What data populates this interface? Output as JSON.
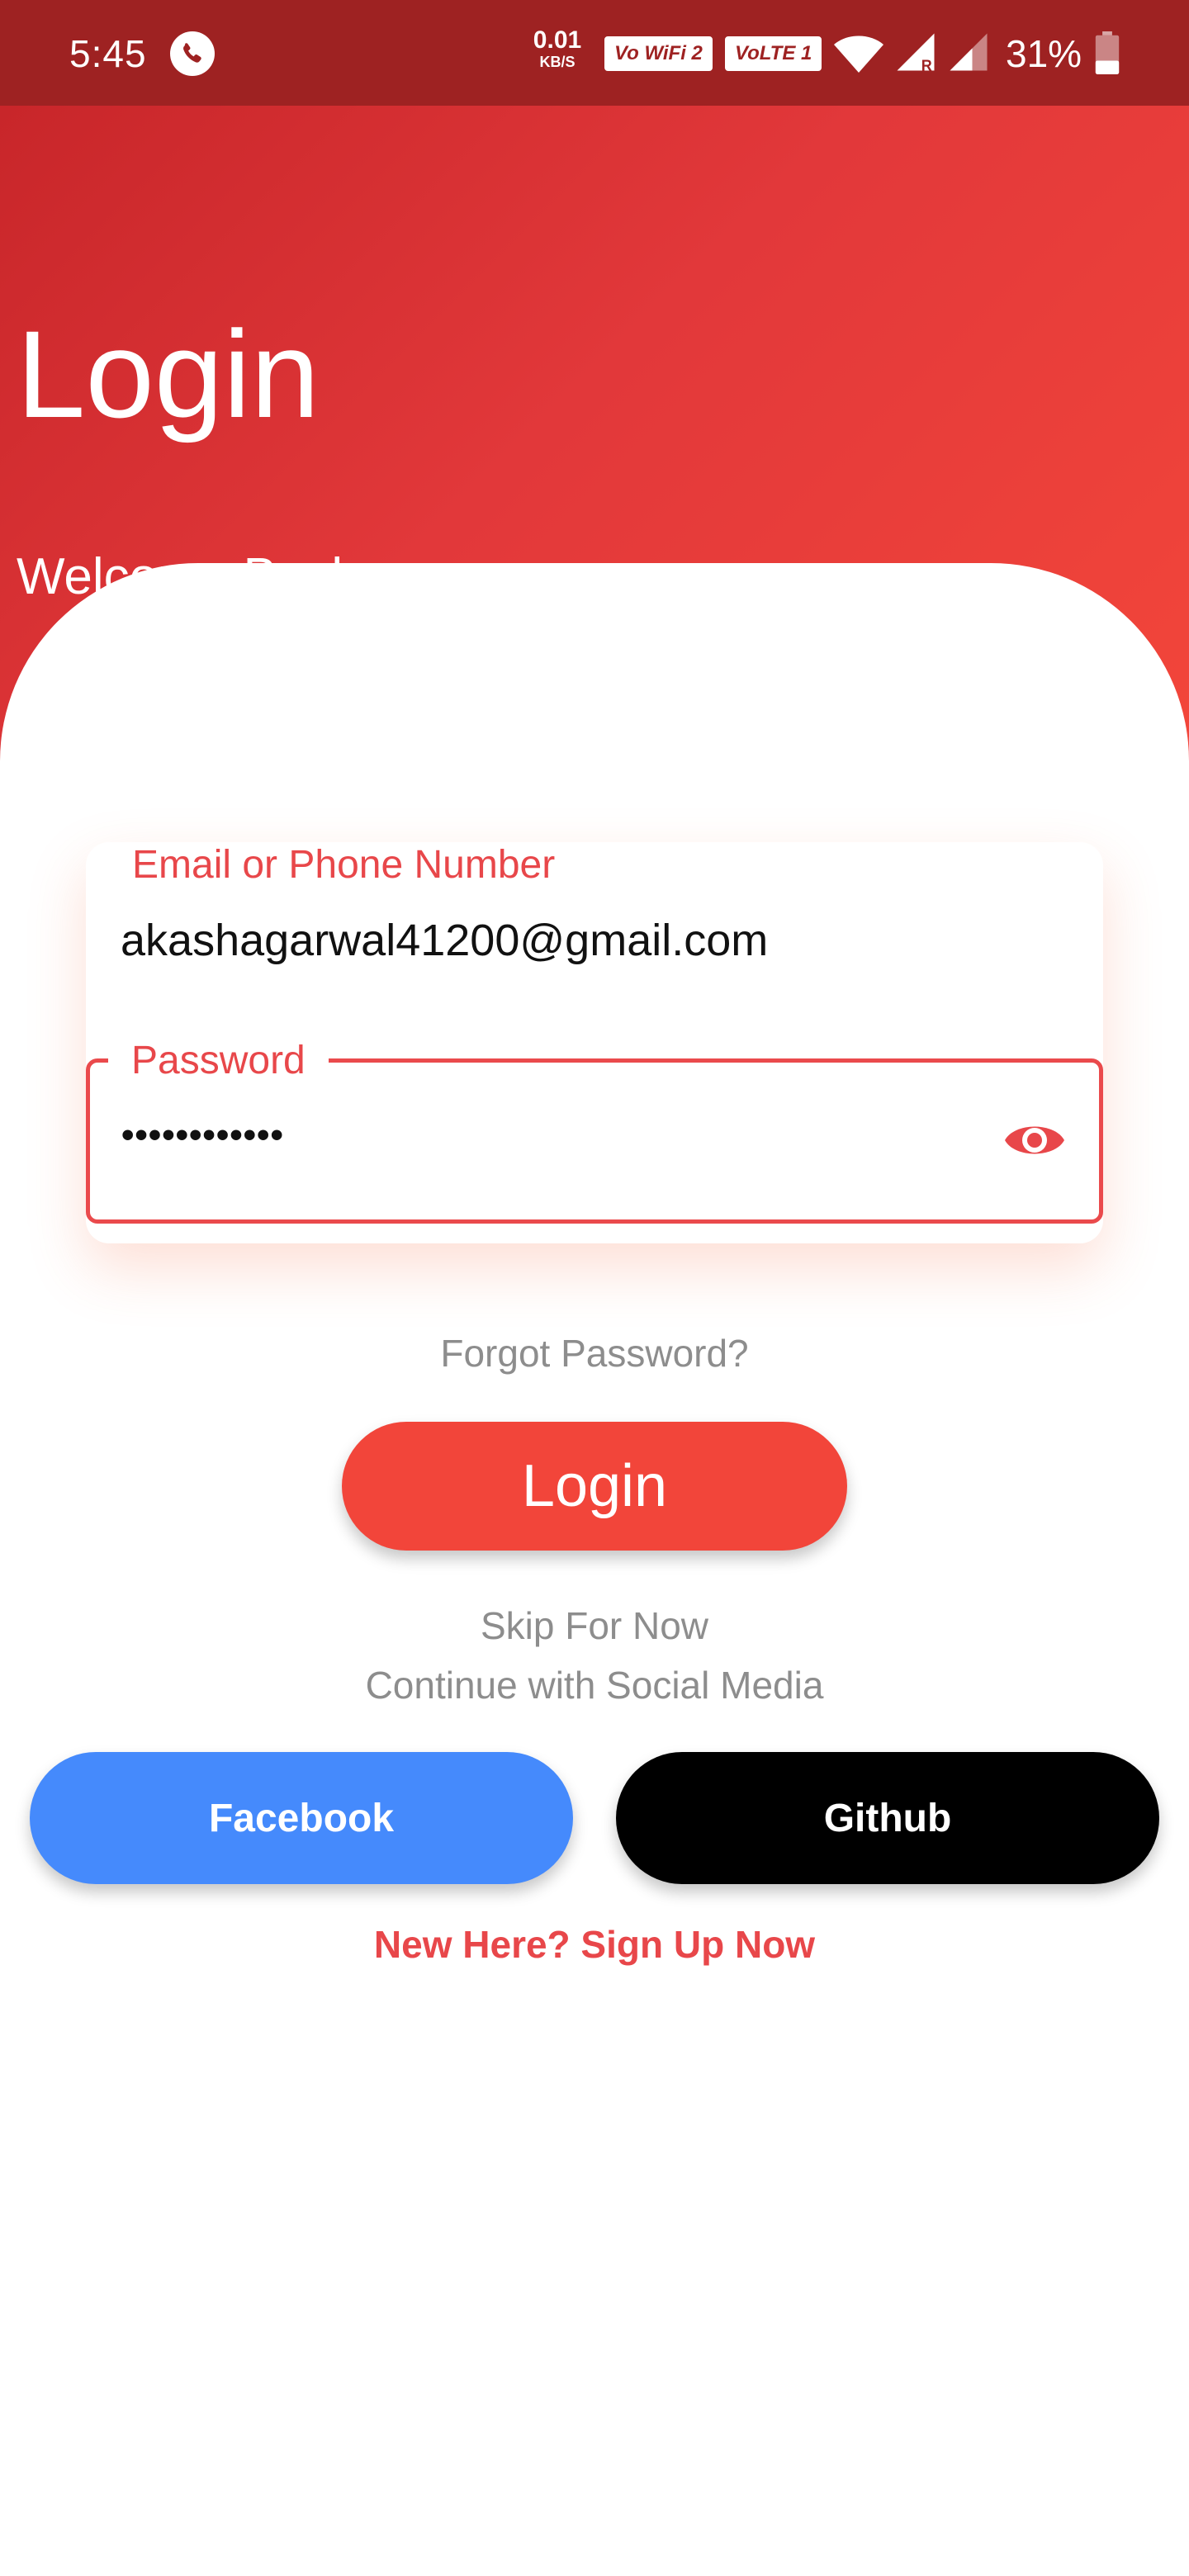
{
  "status_bar": {
    "time": "5:45",
    "net_speed_value": "0.01",
    "net_speed_unit": "KB/S",
    "wifi_badge": "Vo WiFi 2",
    "volte_badge": "VoLTE 1",
    "battery": "31%",
    "icons": [
      "phone-call-icon",
      "wifi-icon",
      "signal-roaming-icon",
      "signal-icon",
      "battery-icon"
    ]
  },
  "header": {
    "title": "Login",
    "subtitle": "Welcome Back"
  },
  "form": {
    "email_label": "Email or Phone Number",
    "email_value": "akashagarwal41200@gmail.com",
    "password_label": "Password",
    "password_value": "••••••••••••",
    "password_toggle_icon": "eye-icon"
  },
  "actions": {
    "forgot_password": "Forgot Password?",
    "login_label": "Login",
    "skip": "Skip For Now",
    "social_caption": "Continue with Social Media",
    "facebook_label": "Facebook",
    "github_label": "Github",
    "signup": "New Here? Sign Up Now"
  },
  "colors": {
    "status_bar": "#9e2222",
    "accent": "#f2453a",
    "field_accent": "#e8474a",
    "facebook": "#458afc",
    "github": "#000000",
    "muted_text": "#8d8d8d"
  }
}
